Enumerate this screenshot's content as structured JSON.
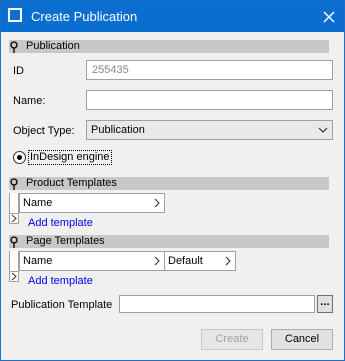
{
  "window": {
    "title": "Create Publication",
    "close_icon": "close-icon",
    "app_icon": "window-icon"
  },
  "sections": {
    "publication": "Publication",
    "product_templates": "Product Templates",
    "page_templates": "Page Templates"
  },
  "form": {
    "id_label": "ID",
    "id_value": "255435",
    "name_label": "Name:",
    "name_value": "",
    "object_type_label": "Object Type:",
    "object_type_value": "Publication",
    "engine_label": "InDesign engine",
    "engine_selected": true,
    "publication_template_label": "Publication Template",
    "publication_template_value": "",
    "browse_label": "..."
  },
  "product_templates": {
    "columns": [
      "Name"
    ],
    "add_label": "Add template"
  },
  "page_templates": {
    "columns": [
      "Name",
      "Default"
    ],
    "add_label": "Add template"
  },
  "buttons": {
    "create": "Create",
    "create_enabled": false,
    "cancel": "Cancel"
  },
  "colors": {
    "titlebar": "#0a6ed1",
    "section_header": "#c8c8c8",
    "link": "#0000ee"
  }
}
